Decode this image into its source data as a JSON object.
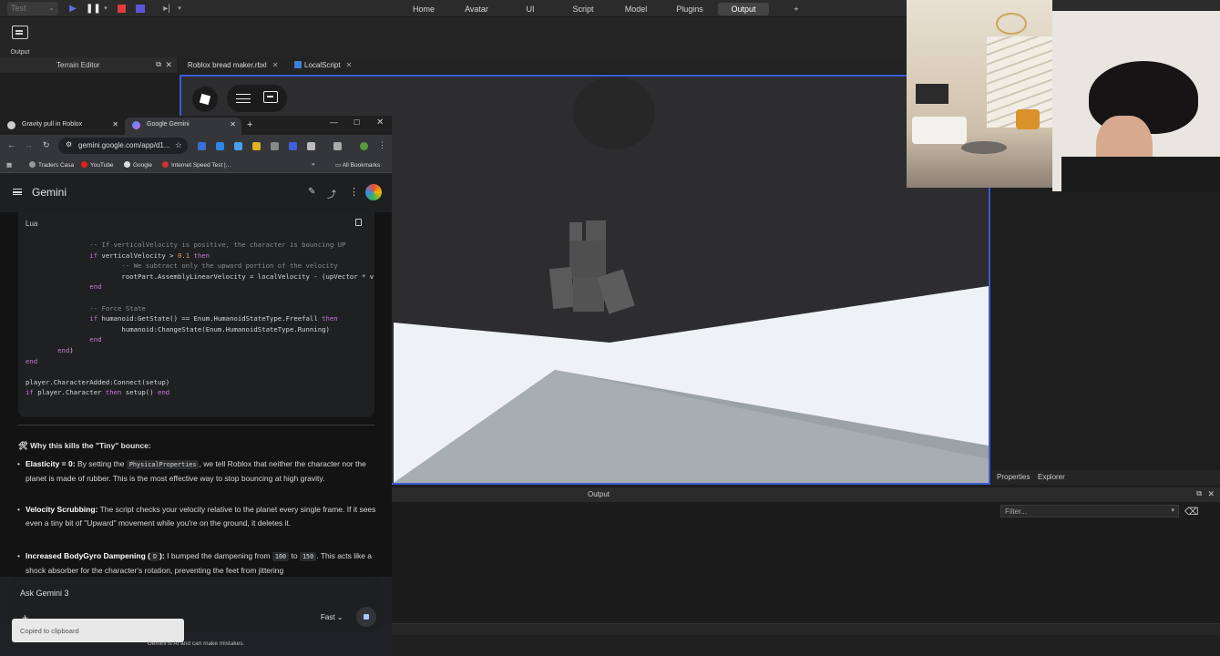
{
  "studio": {
    "mode_select": "Test",
    "menus": [
      "Home",
      "Avatar",
      "UI",
      "Script",
      "Model",
      "Plugins",
      "Output",
      "+"
    ],
    "active_menu": "Output",
    "ribbon_output_label": "Output",
    "terrain_editor_title": "Terrain Editor",
    "doc_tabs": [
      "Roblox bread maker.rbxl",
      "LocalScript"
    ],
    "right_tabs": [
      "Properties",
      "Explorer"
    ],
    "output_panel_title": "Output",
    "filter_placeholder": "Filter...",
    "accent_color": "#3a5bd9"
  },
  "chrome": {
    "tabs": [
      "Gravity pull in Roblox",
      "Google Gemini"
    ],
    "url": "gemini.google.com/app/d1...",
    "bookmarks": [
      "Traders Casa",
      "YouTube",
      "Google",
      "Internet Speed Test |...",
      "All Bookmarks"
    ]
  },
  "gemini": {
    "title": "Gemini",
    "code_lang": "Lua",
    "why_heading": "🛠 Why this kills the \"Tiny\" bounce:",
    "bullets": [
      {
        "title": "Elasticity = 0:",
        "pre": " By setting the ",
        "code": "PhysicalProperties",
        "post": ", we tell Roblox that neither the character nor the planet is made of rubber. This is the most effective way to stop bouncing at high gravity."
      },
      {
        "title": "Velocity Scrubbing:",
        "pre": " The script checks your velocity relative to the planet every single frame. If it sees even a tiny bit of \"Upward\" movement while you're on the ground, it deletes it.",
        "code": "",
        "post": ""
      },
      {
        "title": "Increased BodyGyro Dampening (",
        "code1": "D",
        "title2": "):",
        "pre": " I bumped the dampening from ",
        "code": "100",
        "mid": " to ",
        "code2": "150",
        "post": ". This acts like a shock absorber for the character's rotation, preventing the feet from jittering"
      }
    ],
    "prompt_placeholder": "Ask Gemini 3",
    "model_mode": "Fast",
    "toast": "Copied to clipboard",
    "disclaimer": "Gemini is AI and can make mistakes."
  }
}
